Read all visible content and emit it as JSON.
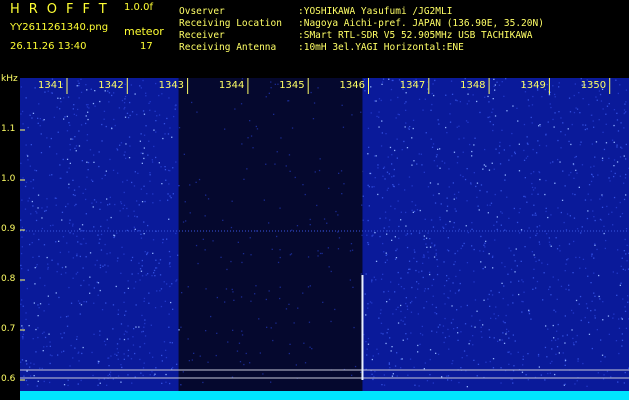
{
  "header": {
    "title": "HROFFT",
    "version": "1.0.0f",
    "filename": "YY2611261340.png",
    "mode": "meteor",
    "timestamp": "26.11.26 13:40",
    "count": "17"
  },
  "info": {
    "rows": [
      {
        "key": "Ovserver",
        "value": ":YOSHIKAWA Yasufumi /JG2MLI"
      },
      {
        "key": "Receiving Location",
        "value": ":Nagoya Aichi-pref. JAPAN (136.90E, 35.20N)"
      },
      {
        "key": "Receiver",
        "value": ":SMart RTL-SDR V5 52.905MHz USB TACHIKAWA"
      },
      {
        "key": "Receiving Antenna",
        "value": ":10mH 3el.YAGI Horizontal:ENE"
      }
    ]
  },
  "colors": {
    "text": "#ffff66",
    "background": "#000000",
    "noise": "#1020b0",
    "baseline": "#00e5ff"
  },
  "chart_data": {
    "type": "heatmap",
    "title": "",
    "xlabel": "",
    "ylabel": "kHz",
    "x_ticks": [
      "1341",
      "1342",
      "1343",
      "1344",
      "1345",
      "1346",
      "1347",
      "1348",
      "1349",
      "1350"
    ],
    "y_ticks": [
      "1.1",
      "1.0",
      "0.9",
      "0.8",
      "0.7",
      "0.6"
    ],
    "ylim": [
      0.58,
      1.19
    ],
    "dark_bands": [
      [
        1342.85,
        1345.9
      ]
    ],
    "meteor_echoes": [
      {
        "x": 1345.9,
        "y_from": 0.6,
        "y_to": 0.81
      }
    ],
    "horizontal_lines": [
      0.62,
      0.604
    ]
  }
}
